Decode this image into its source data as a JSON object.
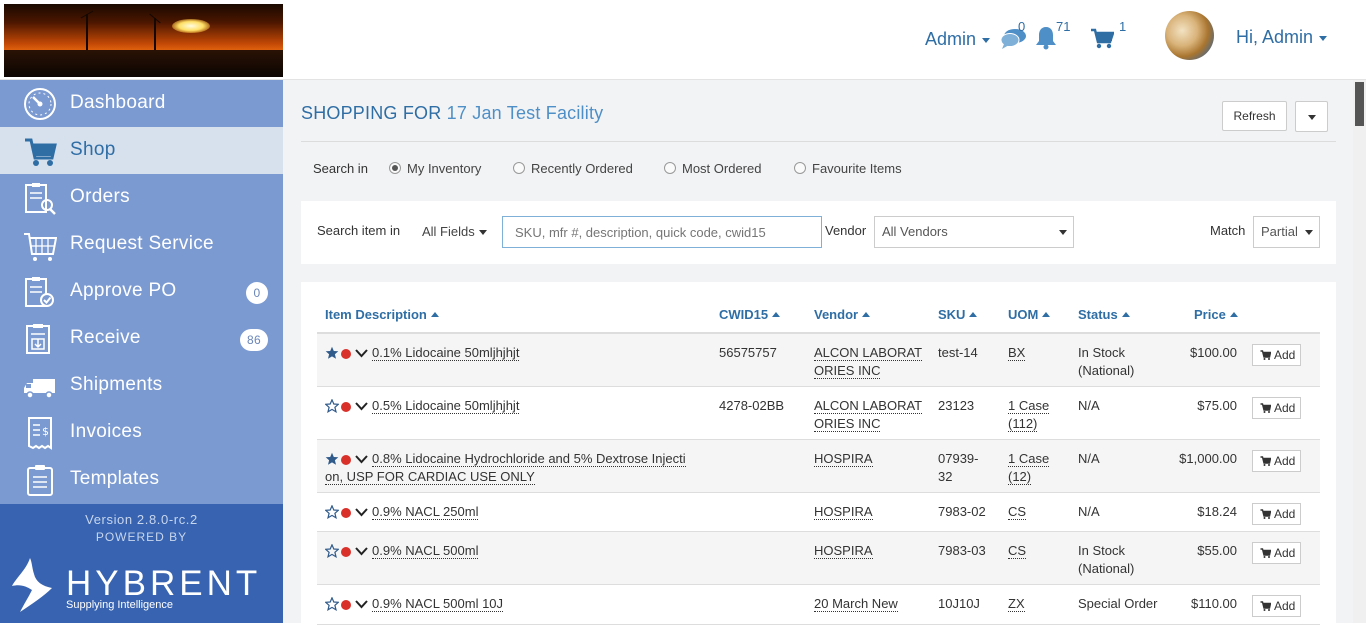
{
  "header": {
    "admin_menu": "Admin",
    "messages_count": "0",
    "notifications_count": "71",
    "cart_count": "1",
    "greeting": "Hi, Admin"
  },
  "sidebar": {
    "items": [
      {
        "label": "Dashboard",
        "icon": "dashboard-icon"
      },
      {
        "label": "Shop",
        "icon": "cart-icon"
      },
      {
        "label": "Orders",
        "icon": "orders-icon"
      },
      {
        "label": "Request Service",
        "icon": "request-service-icon"
      },
      {
        "label": "Approve PO",
        "icon": "approve-po-icon",
        "badge": "0"
      },
      {
        "label": "Receive",
        "icon": "receive-icon",
        "badge": "86"
      },
      {
        "label": "Shipments",
        "icon": "truck-icon"
      },
      {
        "label": "Invoices",
        "icon": "invoice-icon"
      },
      {
        "label": "Templates",
        "icon": "templates-icon"
      }
    ],
    "version": "Version 2.8.0-rc.2",
    "powered_by": "POWERED BY",
    "brand": "HYBRENT",
    "tagline": "Supplying Intelligence"
  },
  "page": {
    "title_prefix": "SHOPPING FOR",
    "facility": "17 Jan Test Facility",
    "refresh_label": "Refresh"
  },
  "search": {
    "search_in_label": "Search in",
    "options": [
      "My Inventory",
      "Recently Ordered",
      "Most Ordered",
      "Favourite Items"
    ],
    "selected": "My Inventory",
    "search_item_in_label": "Search item in",
    "field_select": "All Fields",
    "placeholder": "SKU, mfr #, description, quick code, cwid15",
    "vendor_label": "Vendor",
    "vendor_value": "All Vendors",
    "match_label": "Match",
    "match_value": "Partial"
  },
  "table": {
    "headers": {
      "description": "Item Description",
      "cwid": "CWID15",
      "vendor": "Vendor",
      "sku": "SKU",
      "uom": "UOM",
      "status": "Status",
      "price": "Price"
    },
    "add_label": "Add",
    "rows": [
      {
        "favorite": true,
        "desc1": "0.1% Lidocaine 50mljhjhjt",
        "desc2": "",
        "cwid": "56575757",
        "vendor1": "ALCON LABORAT",
        "vendor2": "ORIES INC",
        "sku1": "test-14",
        "sku2": "",
        "uom1": "BX",
        "uom2": "",
        "status1": "In Stock",
        "status2": "(National)",
        "price": "$100.00"
      },
      {
        "favorite": false,
        "desc1": "0.5% Lidocaine 50mljhjhjt",
        "desc2": "",
        "cwid": "4278-02BB",
        "vendor1": "ALCON LABORAT",
        "vendor2": "ORIES INC",
        "sku1": "23123",
        "sku2": "",
        "uom1": "1 Case",
        "uom2": "(112)",
        "status1": "N/A",
        "status2": "",
        "price": "$75.00"
      },
      {
        "favorite": true,
        "desc1": "0.8% Lidocaine Hydrochloride and 5% Dextrose Injecti",
        "desc2": "on, USP FOR CARDIAC USE ONLY",
        "cwid": "",
        "vendor1": "HOSPIRA",
        "vendor2": "",
        "sku1": "07939-",
        "sku2": "32",
        "uom1": "1 Case",
        "uom2": "(12)",
        "status1": "N/A",
        "status2": "",
        "price": "$1,000.00"
      },
      {
        "favorite": false,
        "desc1": "0.9% NACL 250ml",
        "desc2": "",
        "cwid": "",
        "vendor1": "HOSPIRA",
        "vendor2": "",
        "sku1": "7983-02",
        "sku2": "",
        "uom1": "CS",
        "uom2": "",
        "status1": "N/A",
        "status2": "",
        "price": "$18.24"
      },
      {
        "favorite": false,
        "desc1": "0.9% NACL 500ml",
        "desc2": "",
        "cwid": "",
        "vendor1": "HOSPIRA",
        "vendor2": "",
        "sku1": "7983-03",
        "sku2": "",
        "uom1": "CS",
        "uom2": "",
        "status1": "In Stock",
        "status2": "(National)",
        "price": "$55.00"
      },
      {
        "favorite": false,
        "desc1": "0.9% NACL 500ml 10J",
        "desc2": "",
        "cwid": "",
        "vendor1": "20 March New",
        "vendor2": "",
        "sku1": "10J10J",
        "sku2": "",
        "uom1": "ZX",
        "uom2": "",
        "status1": "Special Order",
        "status2": "",
        "price": "$110.00"
      }
    ]
  }
}
